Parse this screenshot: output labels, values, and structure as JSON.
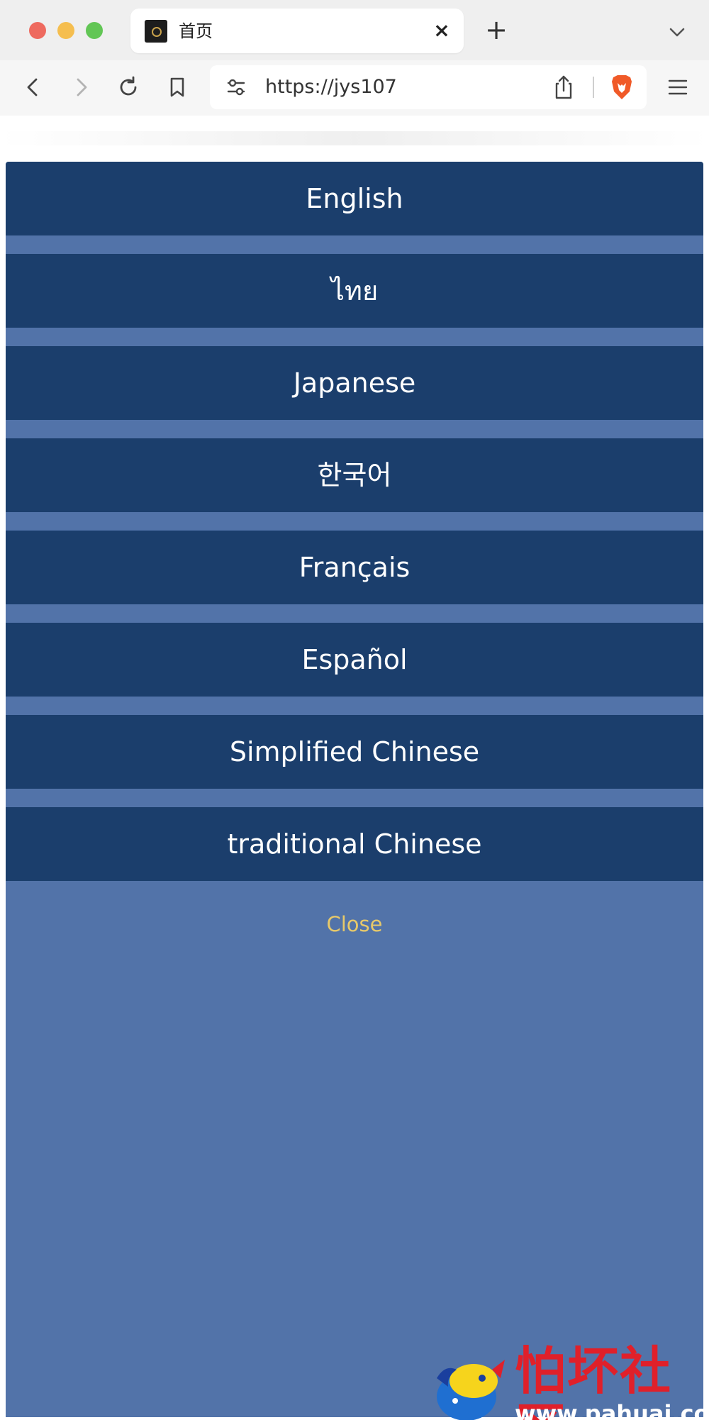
{
  "browser": {
    "tab_title": "首页",
    "tab_close_glyph": "×",
    "new_tab_glyph": "+",
    "url": "https://jys107",
    "icons": {
      "back": "chevron-left-icon",
      "forward": "chevron-right-icon",
      "reload": "reload-icon",
      "bookmark": "bookmark-icon",
      "site_settings": "sliders-icon",
      "share": "share-icon",
      "brave": "brave-lion-icon",
      "menu": "hamburger-menu-icon",
      "tab_list": "chevron-down-icon"
    }
  },
  "language_menu": {
    "items": [
      {
        "label": "English"
      },
      {
        "label": "ไทย"
      },
      {
        "label": "Japanese"
      },
      {
        "label": "한국어"
      },
      {
        "label": "Français"
      },
      {
        "label": "Español"
      },
      {
        "label": "Simplified Chinese"
      },
      {
        "label": "traditional Chinese"
      }
    ],
    "close_label": "Close",
    "colors": {
      "panel": "#5273a9",
      "item": "#1b3e6c",
      "item_text": "#ffffff",
      "close_text": "#e7c96a"
    }
  },
  "watermark": {
    "text": "怕坏社区",
    "url": "www.pahuai.com"
  }
}
